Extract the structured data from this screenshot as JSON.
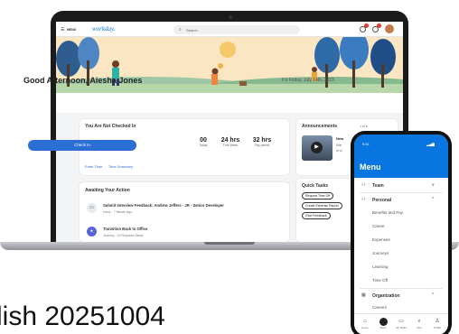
{
  "overlay_text": "lish 20251004",
  "workday": {
    "topbar": {
      "menu_label": "MENU",
      "logo": "workday.",
      "search_placeholder": "Search"
    },
    "greeting": "Good Afternoon, Aiesha Jones",
    "date": "It's Friday, July 14th, 2023",
    "checkin_card": {
      "title": "You Are Not Checked In",
      "button": "Check In",
      "stats": [
        {
          "value": "00",
          "label": "Today"
        },
        {
          "value": "24 hrs",
          "label": "This Week"
        },
        {
          "value": "32 hrs",
          "label": "Pay period"
        }
      ],
      "links": [
        "Enter Time",
        "Time Summary"
      ]
    },
    "announcements": {
      "title": "Announcements",
      "pager": "1 of 6",
      "item_title": "New",
      "item_lines": [
        "We",
        "in a"
      ]
    },
    "awaiting": {
      "title": "Awaiting Your Action",
      "items": [
        {
          "title": "Submit Interview Feedback: Andrew Jeffers - JR - Senior Developer",
          "sub": "Inbox - 7 Minute Ago"
        },
        {
          "title": "Transition Back to Office",
          "sub": "Journey - 10 Required Steps"
        }
      ]
    },
    "quick_tasks": {
      "title": "Quick Tasks",
      "items": [
        "Request Time Off",
        "Create Expense Report",
        "Give Feedback"
      ]
    }
  },
  "phone": {
    "time": "9:41",
    "title": "Menu",
    "rows": [
      {
        "icon": "team-icon",
        "label": "Team",
        "chevron": "v"
      },
      {
        "icon": "personal-icon",
        "label": "Personal",
        "chevron": "^"
      }
    ],
    "personal_items": [
      "Benefits and Pay",
      "Career",
      "Expenses",
      "Journeys",
      "Learning",
      "Time Off"
    ],
    "org": {
      "label": "Organization",
      "chevron": "^"
    },
    "org_items": [
      "Careers"
    ],
    "nav": [
      "Home",
      "Menu",
      "My Tasks",
      "Find",
      "Profile"
    ],
    "colors": {
      "brand": "#0875e1"
    }
  }
}
